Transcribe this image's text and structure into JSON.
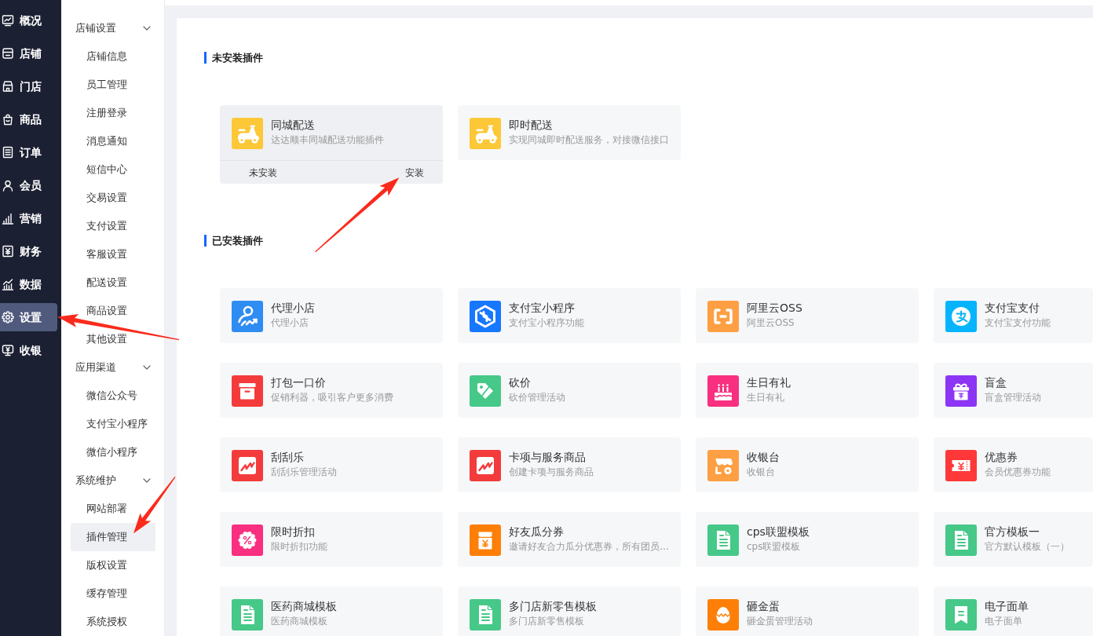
{
  "main_nav": [
    {
      "label": "概况",
      "kind": "monitor",
      "selected": false
    },
    {
      "label": "店铺",
      "kind": "store",
      "selected": false
    },
    {
      "label": "门店",
      "kind": "shop",
      "selected": false
    },
    {
      "label": "商品",
      "kind": "bag",
      "selected": false
    },
    {
      "label": "订单",
      "kind": "list",
      "selected": false
    },
    {
      "label": "会员",
      "kind": "user",
      "selected": false
    },
    {
      "label": "营销",
      "kind": "bars",
      "selected": false
    },
    {
      "label": "财务",
      "kind": "yen",
      "selected": false
    },
    {
      "label": "数据",
      "kind": "data",
      "selected": false
    },
    {
      "label": "设置",
      "kind": "gear",
      "selected": true
    },
    {
      "label": "收银",
      "kind": "cashier",
      "selected": false
    }
  ],
  "sub_nav": [
    {
      "label": "店铺设置",
      "expanded": true,
      "items": [
        {
          "label": "店铺信息",
          "selected": false
        },
        {
          "label": "员工管理",
          "selected": false
        },
        {
          "label": "注册登录",
          "selected": false
        },
        {
          "label": "消息通知",
          "selected": false
        },
        {
          "label": "短信中心",
          "selected": false
        },
        {
          "label": "交易设置",
          "selected": false
        },
        {
          "label": "支付设置",
          "selected": false
        },
        {
          "label": "客服设置",
          "selected": false
        },
        {
          "label": "配送设置",
          "selected": false
        },
        {
          "label": "商品设置",
          "selected": false
        },
        {
          "label": "其他设置",
          "selected": false
        }
      ]
    },
    {
      "label": "应用渠道",
      "expanded": true,
      "items": [
        {
          "label": "微信公众号",
          "selected": false
        },
        {
          "label": "支付宝小程序",
          "selected": false
        },
        {
          "label": "微信小程序",
          "selected": false
        }
      ]
    },
    {
      "label": "系统维护",
      "expanded": true,
      "items": [
        {
          "label": "网站部署",
          "selected": false
        },
        {
          "label": "插件管理",
          "selected": true
        },
        {
          "label": "版权设置",
          "selected": false
        },
        {
          "label": "缓存管理",
          "selected": false
        },
        {
          "label": "系统授权",
          "selected": false
        }
      ]
    }
  ],
  "sections": [
    {
      "title": "未安装插件",
      "plugins": [
        {
          "name": "同城配送",
          "description": "达达顺丰同城配送功能插件",
          "kind": "scooter",
          "color": "#fcc838",
          "footer": {
            "status": "未安装",
            "action": "安装"
          }
        },
        {
          "name": "即时配送",
          "description": "实现同城即时配送服务，对接微信接口",
          "kind": "scooter",
          "color": "#fcc838"
        }
      ]
    },
    {
      "title": "已安装插件",
      "plugins": [
        {
          "name": "代理小店",
          "description": "代理小店",
          "kind": "agent",
          "color": "#2f8cf2"
        },
        {
          "name": "支付宝小程序",
          "description": "支付宝小程序功能",
          "kind": "hexagon",
          "color": "#1677ff"
        },
        {
          "name": "阿里云OSS",
          "description": "阿里云OSS",
          "kind": "bracket",
          "color": "#fd9f42"
        },
        {
          "name": "支付宝支付",
          "description": "支付宝支付功能",
          "kind": "swoosh",
          "color": "#06b4fd"
        },
        {
          "name": "打包一口价",
          "description": "促销利器，吸引客户更多消费",
          "kind": "box",
          "color": "#f43b3b"
        },
        {
          "name": "砍价",
          "description": "砍价管理活动",
          "kind": "tag",
          "color": "#46c888"
        },
        {
          "name": "生日有礼",
          "description": "生日有礼",
          "kind": "cake",
          "color": "#f92f80"
        },
        {
          "name": "盲盒",
          "description": "盲盒管理活动",
          "kind": "gift",
          "color": "#8c35f5"
        },
        {
          "name": "刮刮乐",
          "description": "刮刮乐管理活动",
          "kind": "zigzag",
          "color": "#f43b3b"
        },
        {
          "name": "卡项与服务商品",
          "description": "创建卡项与服务商品",
          "kind": "zigzag",
          "color": "#f43b3b"
        },
        {
          "name": "收银台",
          "description": "收银台",
          "kind": "shop",
          "color": "#fd9f42"
        },
        {
          "name": "优惠券",
          "description": "会员优惠券功能",
          "kind": "ticket",
          "color": "#fe3838"
        },
        {
          "name": "限时折扣",
          "description": "限时折扣功能",
          "kind": "percent",
          "color": "#f92f80"
        },
        {
          "name": "好友瓜分券",
          "description": "邀请好友合力瓜分优惠券，所有团员…",
          "kind": "pouch",
          "color": "#fe7f08"
        },
        {
          "name": "cps联盟模板",
          "description": "cps联盟模板",
          "kind": "document",
          "color": "#46c888"
        },
        {
          "name": "官方模板一",
          "description": "官方默认模板（一）",
          "kind": "document",
          "color": "#46c888"
        },
        {
          "name": "医药商城模板",
          "description": "医药商城模板",
          "kind": "document",
          "color": "#46c888"
        },
        {
          "name": "多门店新零售模板",
          "description": "多门店新零售模板",
          "kind": "document",
          "color": "#46c888"
        },
        {
          "name": "砸金蛋",
          "description": "砸金蛋管理活动",
          "kind": "egg",
          "color": "#fe7f08"
        },
        {
          "name": "电子面单",
          "description": "电子面单",
          "kind": "bookmark",
          "color": "#46c888"
        }
      ]
    }
  ]
}
